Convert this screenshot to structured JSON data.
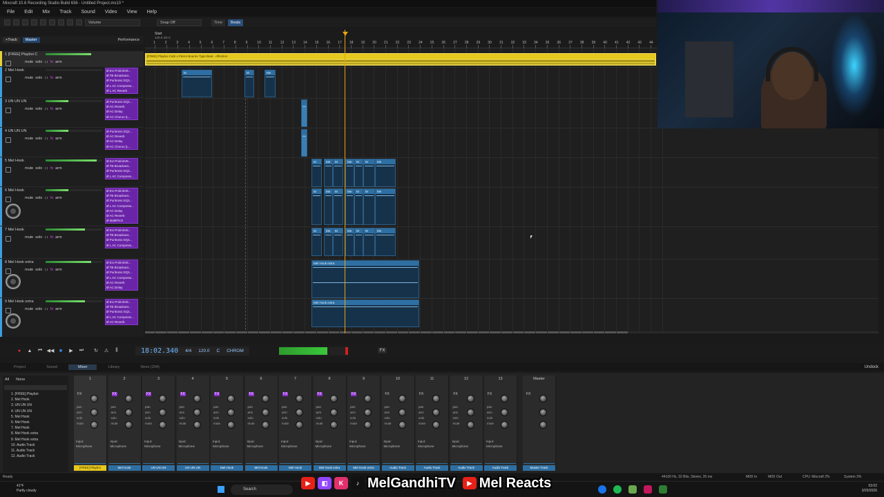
{
  "window": {
    "title": "Mixcraft 10.6 Recording Studio Build 636 - Untitled Project.mx10 *"
  },
  "menu": [
    "File",
    "Edit",
    "Mix",
    "Track",
    "Sound",
    "Video",
    "View",
    "Help"
  ],
  "toolbar": {
    "volume_label": "Volume",
    "snap_label": "Snap Off",
    "time_label": "Time",
    "beats_label": "Beats"
  },
  "track_header": {
    "add_track": "+Track",
    "master": "Master",
    "performance": "Performance"
  },
  "tracks": [
    {
      "num": "1",
      "name": "[FREE] Playboi C",
      "color": "#e6d23a",
      "selected": true,
      "fx": []
    },
    {
      "num": "2",
      "name": "Mel Hook",
      "color": "#3aa0e0",
      "fx": [
        "EU ProlinkVE...",
        "TB Broadcast...",
        "Puritronic EQ1...",
        "L AC Compress...",
        "L AC Reverb"
      ]
    },
    {
      "num": "3",
      "name": "UN UN UN",
      "color": "#3aa0e0",
      "fx": [
        "Puritronic EQ1...",
        "AC Reverb",
        "AC Delay",
        "AC Chorus (L..."
      ]
    },
    {
      "num": "4",
      "name": "UN UN UN",
      "color": "#3aa0e0",
      "fx": [
        "Puritronic EQ1...",
        "AC Reverb",
        "AC Delay",
        "AC Chorus (L..."
      ]
    },
    {
      "num": "5",
      "name": "Mel Hook",
      "color": "#3aa0e0",
      "fx": [
        "EU ProlinkVE...",
        "TB Broadcast...",
        "Puritronic EQ1...",
        "L AC Compress..."
      ]
    },
    {
      "num": "6",
      "name": "Mel Hook",
      "color": "#3aa0e0",
      "fx": [
        "EU ProlinkVE...",
        "TB Broadcast...",
        "Puritronic EQ1...",
        "L AC Compress...",
        "AC Delay",
        "AC Reverb",
        "MultiPitch"
      ]
    },
    {
      "num": "7",
      "name": "Mel Hook",
      "color": "#3aa0e0",
      "fx": [
        "EU ProlinkVE...",
        "TB Broadcast...",
        "Puritronic EQ1...",
        "L AC Compress..."
      ]
    },
    {
      "num": "8",
      "name": "Mel Hook extra",
      "color": "#3aa0e0",
      "fx": [
        "EU ProlinkVE...",
        "TB Broadcast...",
        "Puritronic EQ1...",
        "L AC Compress...",
        "AC Reverb",
        "AC Delay"
      ]
    },
    {
      "num": "9",
      "name": "Mel Hook extra",
      "color": "#3aa0e0",
      "fx": [
        "EU ProlinkVE...",
        "TB Broadcast...",
        "Puritronic EQ1...",
        "L AC Compress...",
        "AC Reverb"
      ]
    }
  ],
  "track_ctrl": {
    "mute": "mute",
    "solo": "solo",
    "fx": "fx",
    "arm": "arm"
  },
  "ruler": {
    "start": "Start",
    "sig": "120.0 4/4 C",
    "numbers": [
      "1",
      "2",
      "3",
      "4",
      "5",
      "6",
      "7",
      "8",
      "9",
      "10",
      "11",
      "12",
      "13",
      "14",
      "15",
      "16",
      "17",
      "18",
      "19",
      "20",
      "21",
      "22",
      "23",
      "24",
      "25",
      "26",
      "27",
      "28",
      "29",
      "30",
      "31",
      "32",
      "33",
      "34",
      "35",
      "36",
      "37",
      "38",
      "39",
      "40",
      "41",
      "42",
      "43",
      "44",
      "45"
    ]
  },
  "clips": {
    "beat_title": "[FREE] Playboi Carti x Pierre Bourne Type Beat - Affection",
    "m_label": "M",
    "me_label": "Me",
    "hook_extra": "Mel Hook extra"
  },
  "transport": {
    "time": "18:02.340",
    "sig": "4/4",
    "tempo": "120.0",
    "key": "C",
    "mode": "CHROM",
    "fx": "FX"
  },
  "tabs": [
    "Project",
    "Sound",
    "Mixer",
    "Library",
    "Store (204)"
  ],
  "active_tab": "Mixer",
  "undock": "Undock",
  "mixer_list": {
    "all": "All",
    "none": "None",
    "items": [
      "1. [FREE] Playboi",
      "2. Mel Hook",
      "3. UN UN UN",
      "4. UN UN UN",
      "5. Mel Hook",
      "6. Mel Hook",
      "7. Mel Hook",
      "8. Mel Hook extra",
      "9. Mel Hook extra",
      "10. Audio Track",
      "11. Audio Track",
      "12. Audio Track"
    ]
  },
  "strips": [
    {
      "num": "1",
      "label": "[FREE] Playboi",
      "color": "#e6c81e",
      "fx_on": false
    },
    {
      "num": "2",
      "label": "Mel Hook",
      "color": "#2e6fa3",
      "fx_on": true
    },
    {
      "num": "3",
      "label": "UN UN UN",
      "color": "#2e6fa3",
      "fx_on": true
    },
    {
      "num": "4",
      "label": "UN UN UN",
      "color": "#2e6fa3",
      "fx_on": true
    },
    {
      "num": "5",
      "label": "Mel Hook",
      "color": "#2e6fa3",
      "fx_on": true
    },
    {
      "num": "6",
      "label": "Mel Hook",
      "color": "#2e6fa3",
      "fx_on": true
    },
    {
      "num": "7",
      "label": "Mel Hook",
      "color": "#2e6fa3",
      "fx_on": true
    },
    {
      "num": "8",
      "label": "Mel Hook extra",
      "color": "#2e6fa3",
      "fx_on": true
    },
    {
      "num": "9",
      "label": "Mel Hook extra",
      "color": "#2e6fa3",
      "fx_on": true
    },
    {
      "num": "10",
      "label": "Audio Track",
      "color": "#2e6fa3",
      "fx_on": false
    },
    {
      "num": "11",
      "label": "Audio Track",
      "color": "#2e6fa3",
      "fx_on": false
    },
    {
      "num": "12",
      "label": "Audio Track",
      "color": "#2e6fa3",
      "fx_on": false
    },
    {
      "num": "13",
      "label": "Audio Track",
      "color": "#2e6fa3",
      "fx_on": false
    }
  ],
  "strip_text": {
    "fx": "FX",
    "eq": "EQ",
    "pan": "pan",
    "arm": "arm",
    "solo": "solo",
    "mute": "mute",
    "input": "Input:",
    "mic": "Microphone"
  },
  "master_strip": {
    "name": "Master",
    "label": "Master Track"
  },
  "status": {
    "left": "Ready",
    "format": "44100 Hz, 32 Bits, Stereo, 20 ms",
    "midi_in": "MIDI In",
    "midi_out": "MIDI Out",
    "cpu": "CPU: Mixcraft 2%",
    "system": "System 3%"
  },
  "taskbar": {
    "temp": "41°F",
    "weather": "Partly cloudy",
    "search": "Search",
    "time": "03:02",
    "date": "3/25/2026"
  },
  "social": {
    "handle1": "MelGandhiTV",
    "handle2": "Mel Reacts"
  }
}
